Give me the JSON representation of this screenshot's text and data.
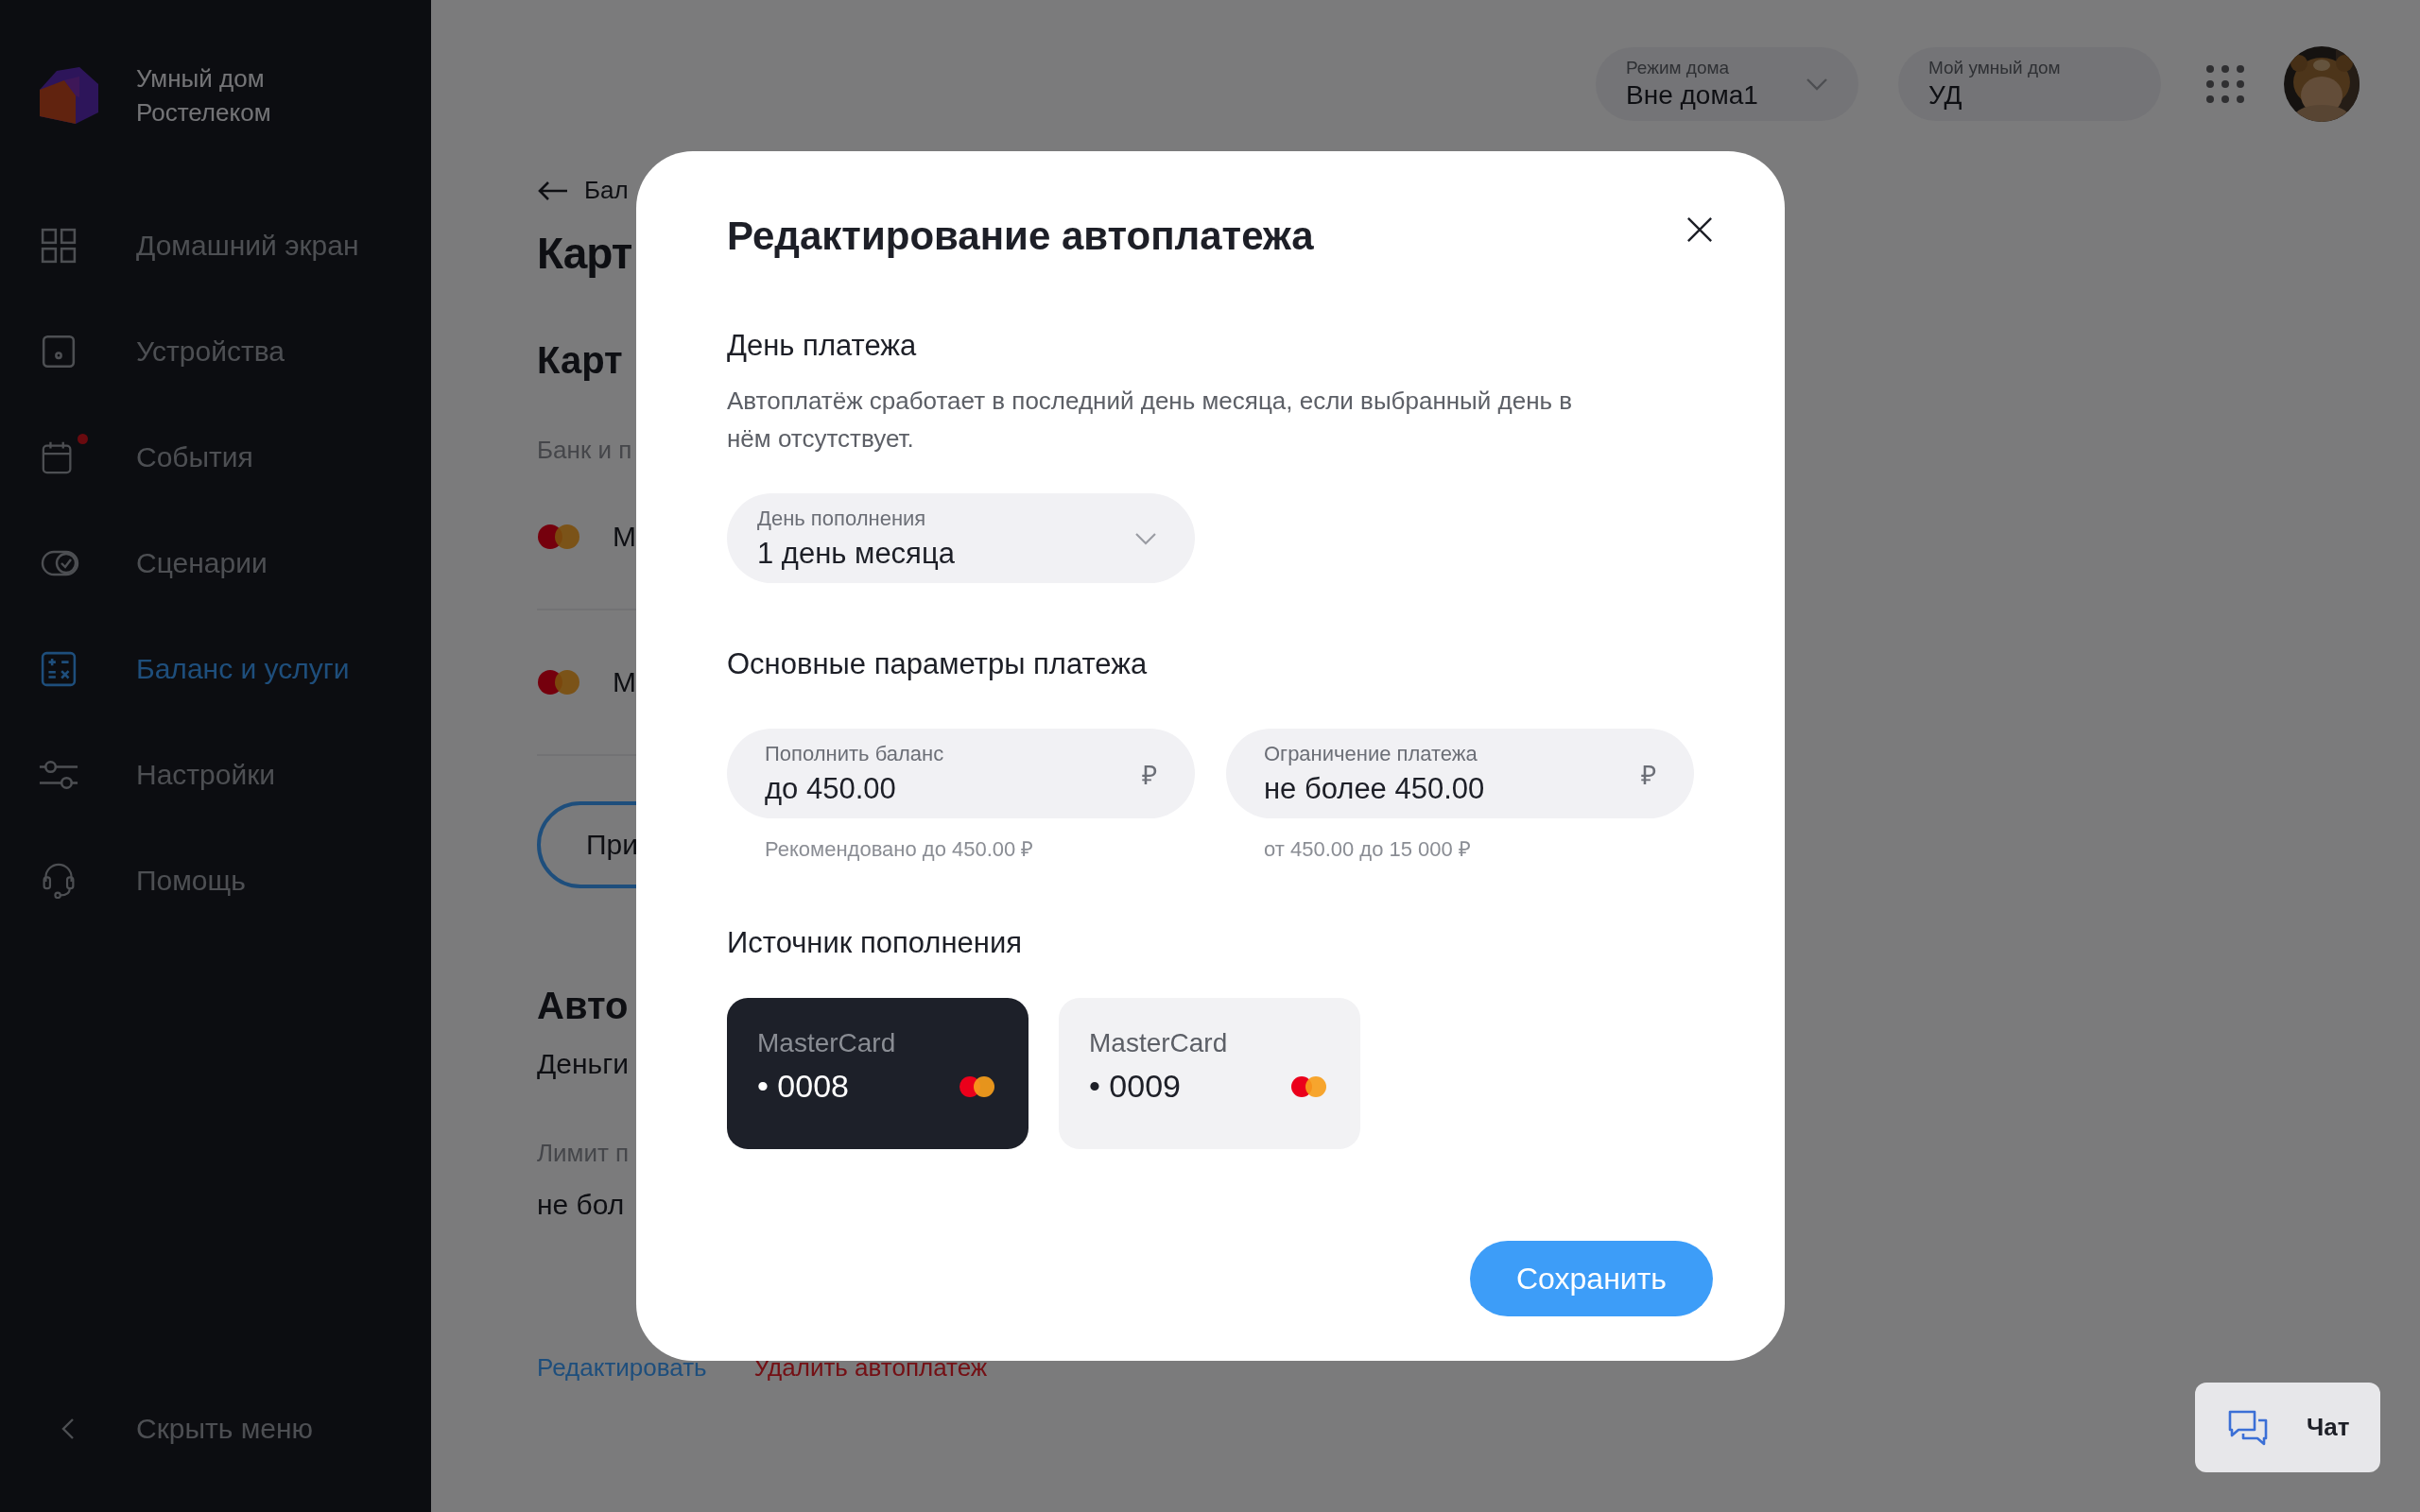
{
  "sidebar": {
    "brand_lines": [
      "Умный дом",
      "Ростелеком"
    ],
    "items": [
      {
        "label": "Домашний экран",
        "selected": false,
        "notification": false
      },
      {
        "label": "Устройства",
        "selected": false,
        "notification": false
      },
      {
        "label": "События",
        "selected": false,
        "notification": true
      },
      {
        "label": "Сценарии",
        "selected": false,
        "notification": false
      },
      {
        "label": "Баланс и услуги",
        "selected": true,
        "notification": false
      },
      {
        "label": "Настройки",
        "selected": false,
        "notification": false
      },
      {
        "label": "Помощь",
        "selected": false,
        "notification": false
      }
    ],
    "collapse_label": "Скрыть меню"
  },
  "header": {
    "home_mode": {
      "label": "Режим дома",
      "value": "Вне дома1"
    },
    "home": {
      "label": "Мой умный дом",
      "value": "УД"
    }
  },
  "page": {
    "back_label": "Бал",
    "title": "Карт",
    "section_title": "Карт",
    "subtitle": "Банк и п",
    "cards": [
      {
        "label": "М"
      },
      {
        "label": "М"
      }
    ],
    "add_button": "При",
    "autopay_title": "Авто",
    "autopay_text": "Деньги",
    "limit_label": "Лимит п",
    "limit_value": "не бол",
    "links": [
      {
        "label": "Редактировать",
        "kind": "edit"
      },
      {
        "label": "Удалить автоплатеж",
        "kind": "delete"
      }
    ]
  },
  "modal": {
    "title": "Редактирование автоплатежа",
    "day_section": "День платежа",
    "day_note": "Автоплатёж сработает в последний день месяца, если выбранный день в нём отсутствует.",
    "day_select": {
      "label": "День пополнения",
      "value": "1 день месяца"
    },
    "params_section": "Основные параметры платежа",
    "fields": [
      {
        "label": "Пополнить баланс",
        "value": "до 450.00",
        "currency": "₽",
        "hint": "Рекомендовано до 450.00 ₽"
      },
      {
        "label": "Ограничение платежа",
        "value": "не более  450.00",
        "currency": "₽",
        "hint": "от 450.00 до 15 000 ₽"
      }
    ],
    "source_section": "Источник пополнения",
    "cards": [
      {
        "name": "MasterCard",
        "number": "• 0008",
        "selected": true
      },
      {
        "name": "MasterCard",
        "number": "• 0009",
        "selected": false
      }
    ],
    "save_button": "Сохранить"
  },
  "chat": {
    "label": "Чат"
  }
}
